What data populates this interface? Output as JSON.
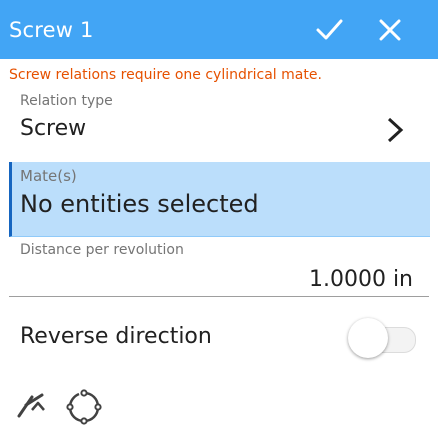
{
  "header": {
    "title": "Screw 1",
    "accent_color": "#42a5f5",
    "ok_icon": "check-icon",
    "cancel_icon": "close-icon"
  },
  "error_message": "Screw relations require one cylindrical mate.",
  "relation_type": {
    "label": "Relation type",
    "value": "Screw",
    "icon": "chevron-right-icon"
  },
  "mates": {
    "label": "Mate(s)",
    "value": "No entities selected",
    "highlight_color": "#bbdefb"
  },
  "distance": {
    "label": "Distance per revolution",
    "value": "1.0000 in"
  },
  "reverse": {
    "label": "Reverse direction",
    "enabled": false
  },
  "footer": {
    "icons": [
      "mate-connector-icon",
      "cylinder-select-icon"
    ]
  }
}
